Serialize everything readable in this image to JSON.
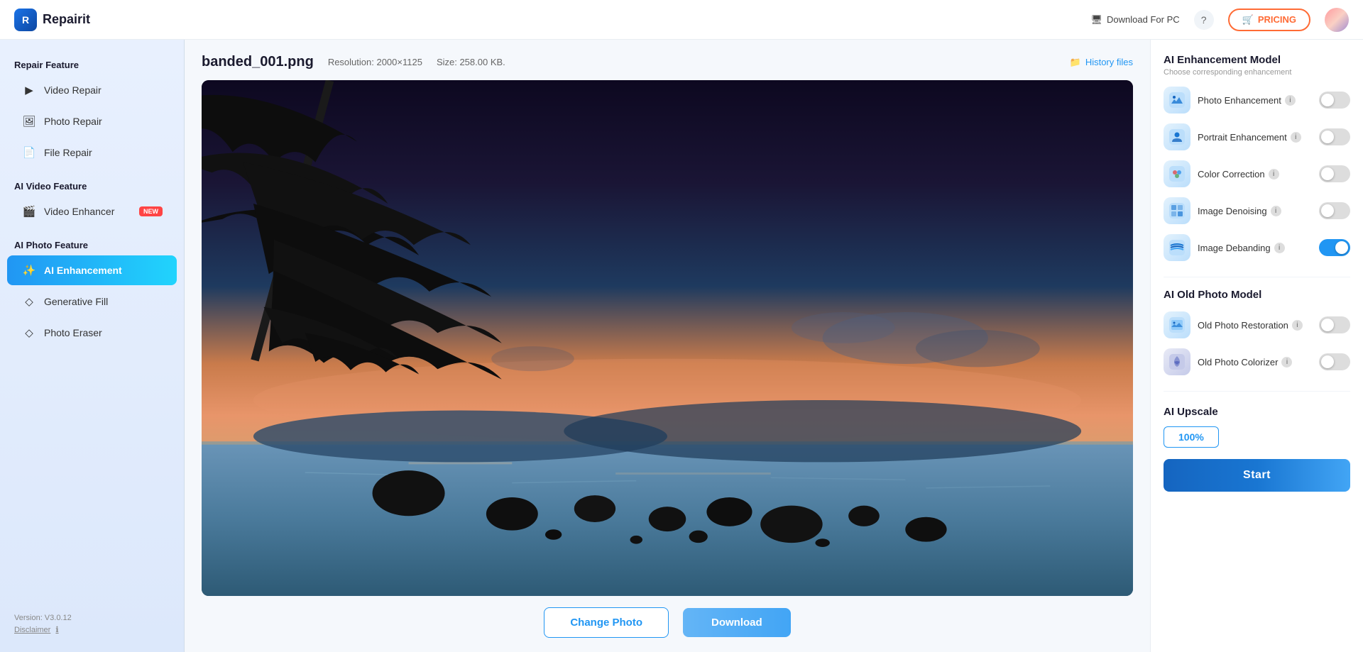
{
  "header": {
    "logo_text": "Repairit",
    "download_pc": "Download For PC",
    "pricing_label": "PRICING",
    "pricing_icon": "🛒"
  },
  "sidebar": {
    "repair_section": "Repair Feature",
    "repair_items": [
      {
        "id": "video-repair",
        "icon": "▶",
        "label": "Video Repair",
        "active": false
      },
      {
        "id": "photo-repair",
        "icon": "🖼",
        "label": "Photo Repair",
        "active": false
      },
      {
        "id": "file-repair",
        "icon": "📄",
        "label": "File Repair",
        "active": false
      }
    ],
    "ai_video_section": "AI Video Feature",
    "ai_video_items": [
      {
        "id": "video-enhancer",
        "icon": "🎬",
        "label": "Video Enhancer",
        "badge": "NEW",
        "active": false
      }
    ],
    "ai_photo_section": "AI Photo Feature",
    "ai_photo_items": [
      {
        "id": "ai-enhancement",
        "icon": "✨",
        "label": "AI Enhancement",
        "active": true
      },
      {
        "id": "generative-fill",
        "icon": "◇",
        "label": "Generative Fill",
        "active": false
      },
      {
        "id": "photo-eraser",
        "icon": "◇",
        "label": "Photo Eraser",
        "active": false
      }
    ],
    "version": "Version: V3.0.12",
    "disclaimer": "Disclaimer"
  },
  "file_info": {
    "filename": "banded_001.png",
    "resolution_label": "Resolution: 2000×1125",
    "size_label": "Size: 258.00 KB.",
    "history_files": "History files"
  },
  "right_panel": {
    "ai_enhancement": {
      "title": "AI Enhancement Model",
      "subtitle": "Choose corresponding enhancement",
      "features": [
        {
          "id": "photo-enhancement",
          "label": "Photo Enhancement",
          "icon": "🌄",
          "on": false
        },
        {
          "id": "portrait-enhancement",
          "label": "Portrait Enhancement",
          "icon": "👤",
          "on": false
        },
        {
          "id": "color-correction",
          "label": "Color Correction",
          "icon": "🎨",
          "on": false
        },
        {
          "id": "image-denoising",
          "label": "Image Denoising",
          "icon": "🔲",
          "on": false
        },
        {
          "id": "image-debanding",
          "label": "Image Debanding",
          "icon": "🌊",
          "on": true
        }
      ]
    },
    "ai_old_photo": {
      "title": "AI Old Photo Model",
      "features": [
        {
          "id": "old-photo-restoration",
          "label": "Old Photo Restoration",
          "icon": "🖼",
          "on": false
        },
        {
          "id": "old-photo-colorizer",
          "label": "Old Photo Colorizer",
          "icon": "🎨",
          "on": false
        }
      ]
    },
    "ai_upscale": {
      "title": "AI Upscale",
      "value": "100%",
      "start_label": "Start"
    }
  },
  "actions": {
    "change_photo": "Change Photo",
    "download": "Download"
  }
}
